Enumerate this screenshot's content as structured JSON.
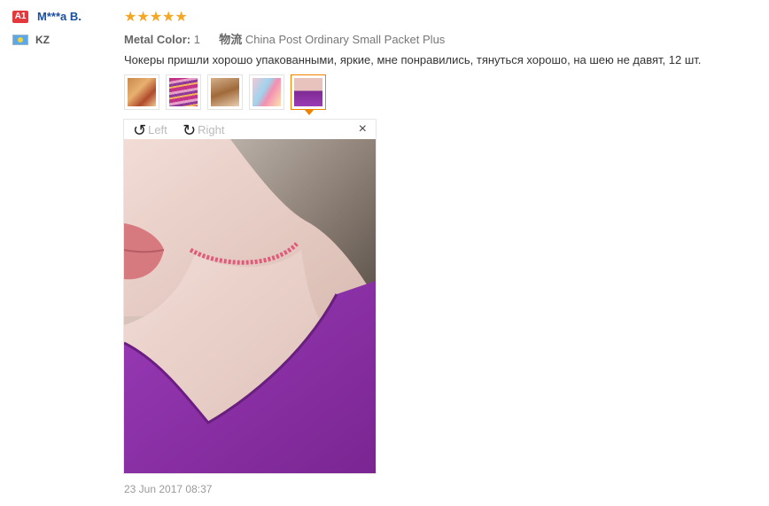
{
  "reviewer": {
    "badge": "A1",
    "name": "M***a B.",
    "country": "KZ"
  },
  "review": {
    "stars": "★★★★★",
    "meta": {
      "color_key": "Metal Color:",
      "color_value": "1",
      "shipping_key": "物流",
      "shipping_value": "China Post Ordinary Small Packet Plus"
    },
    "text": "Чокеры пришли хорошо упакованными, яркие, мне понравились, тянуться хорошо, на шею не давят, 12 шт.",
    "date": "23 Jun 2017 08:37"
  },
  "viewer": {
    "left_label": "Left",
    "right_label": "Right",
    "close_label": "×",
    "left_icon": "↺",
    "right_icon": "↻"
  },
  "colors": {
    "accent": "#f08200",
    "name_blue": "#1a4fa0",
    "star": "#f5a623",
    "badge_red": "#e4393c"
  },
  "icons": [
    "rotate-left-icon",
    "rotate-right-icon",
    "close-icon",
    "flag-icon",
    "star-icon"
  ]
}
